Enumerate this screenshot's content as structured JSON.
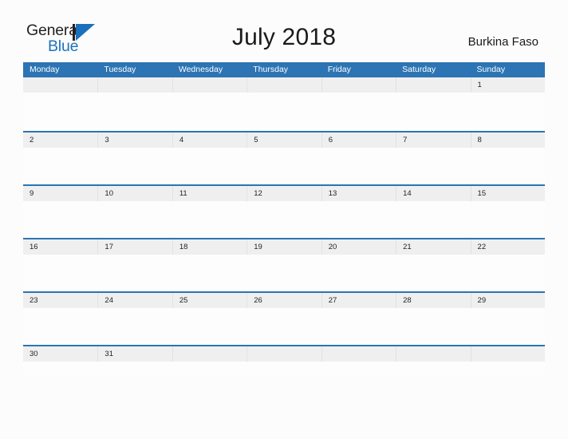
{
  "logo": {
    "text_top": "General",
    "text_bottom": "Blue",
    "flag_icon": "blue-flag-triangle",
    "color_dark": "#231f20",
    "color_blue": "#1c74bc"
  },
  "header": {
    "title": "July 2018",
    "country": "Burkina Faso"
  },
  "theme": {
    "header_blue": "#2c74b3",
    "band_gray": "#efefef",
    "page_background": "#fcfcfd",
    "text_dark": "#231f20"
  },
  "calendar": {
    "month": "July",
    "year": "2018",
    "weekday_headers": [
      "Monday",
      "Tuesday",
      "Wednesday",
      "Thursday",
      "Friday",
      "Saturday",
      "Sunday"
    ],
    "weeks": [
      {
        "days": [
          "",
          "",
          "",
          "",
          "",
          "",
          "1"
        ]
      },
      {
        "days": [
          "2",
          "3",
          "4",
          "5",
          "6",
          "7",
          "8"
        ]
      },
      {
        "days": [
          "9",
          "10",
          "11",
          "12",
          "13",
          "14",
          "15"
        ]
      },
      {
        "days": [
          "16",
          "17",
          "18",
          "19",
          "20",
          "21",
          "22"
        ]
      },
      {
        "days": [
          "23",
          "24",
          "25",
          "26",
          "27",
          "28",
          "29"
        ]
      },
      {
        "days": [
          "30",
          "31",
          "",
          "",
          "",
          "",
          ""
        ]
      }
    ]
  }
}
